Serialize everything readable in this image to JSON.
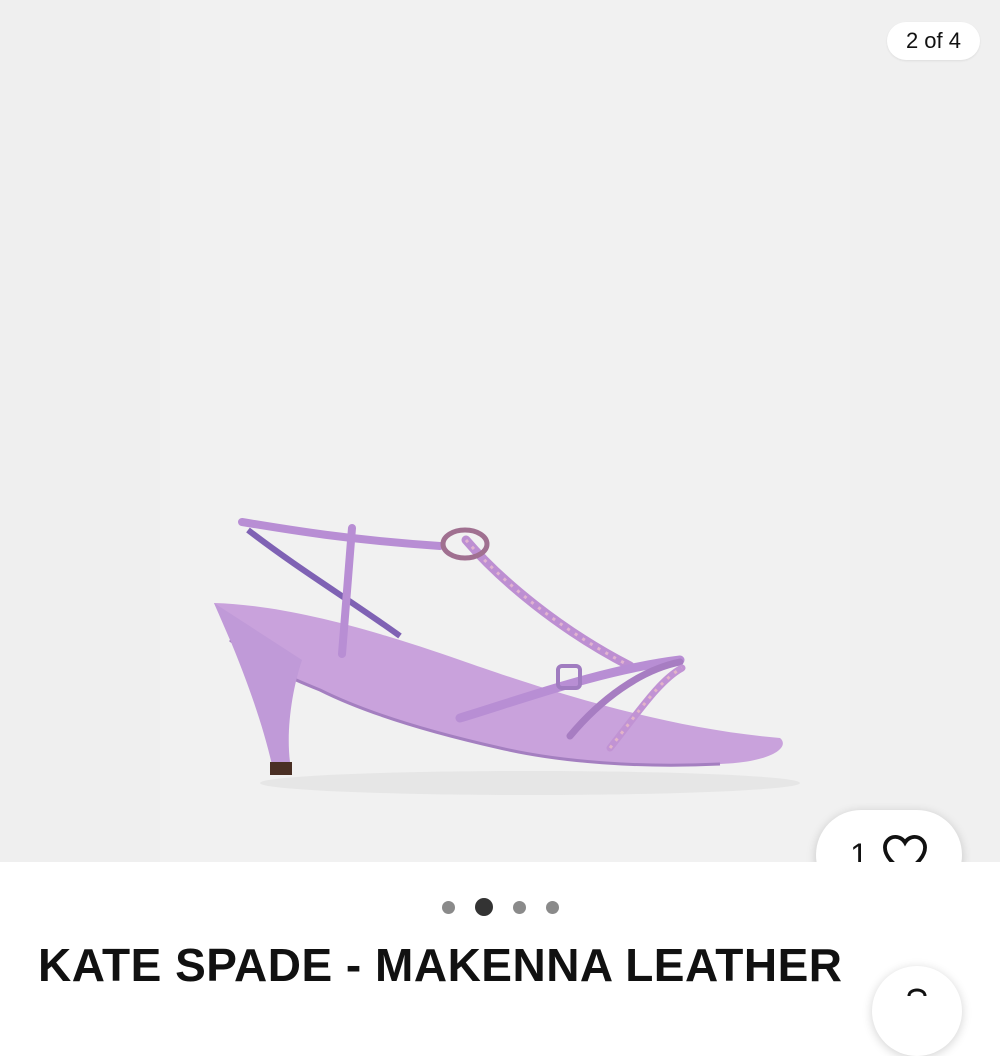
{
  "gallery": {
    "counter_text": "2 of 4",
    "image_alt": "Purple metallic strappy sandal",
    "current_index": 2,
    "total": 4
  },
  "like": {
    "count": "1",
    "icon": "heart-outline-icon"
  },
  "carousel_dots": [
    "dot-1",
    "dot-2",
    "dot-3",
    "dot-4"
  ],
  "product": {
    "title": "KATE SPADE - MAKENNA LEATHER"
  },
  "colors": {
    "background": "#f1f1f1",
    "sandal": "#c9a2dc",
    "accent_dark": "#333333"
  }
}
